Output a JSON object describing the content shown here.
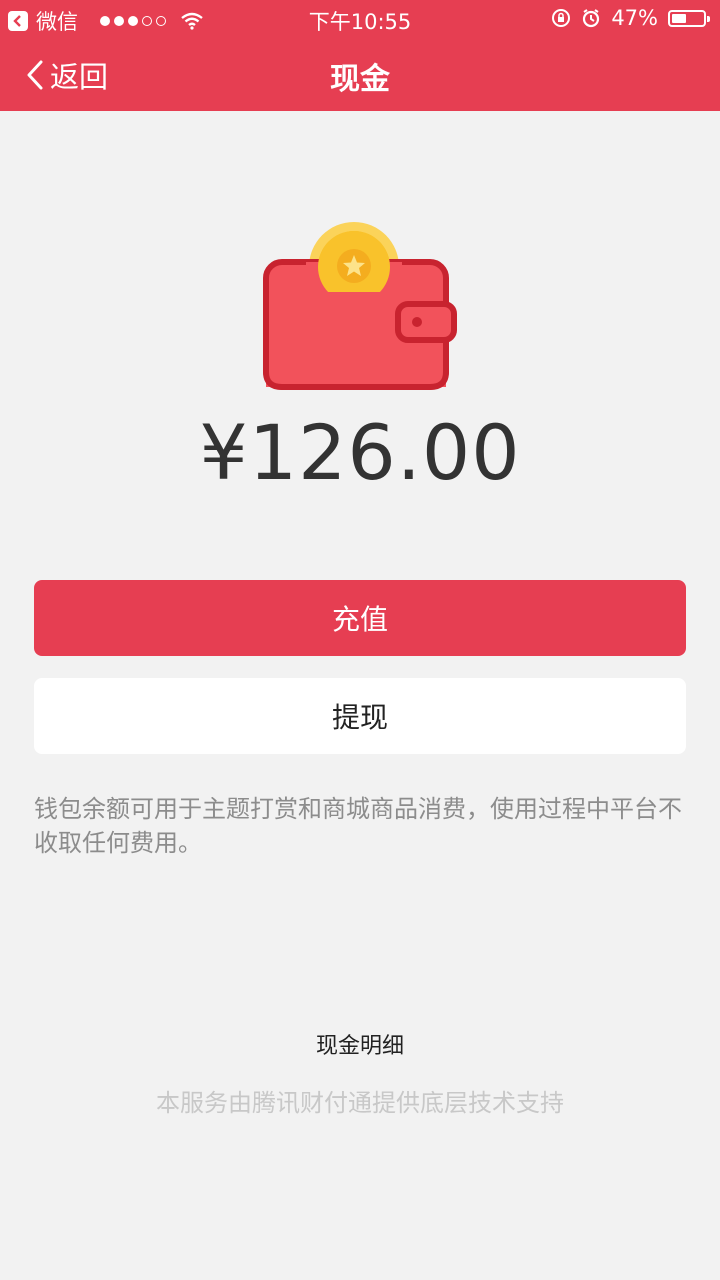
{
  "status_bar": {
    "carrier": "微信",
    "time": "下午10:55",
    "battery_percent": "47%",
    "battery_level": 0.47
  },
  "nav": {
    "back_label": "返回",
    "title": "现金"
  },
  "wallet": {
    "amount": "¥126.00"
  },
  "actions": {
    "recharge_label": "充值",
    "withdraw_label": "提现"
  },
  "note": "钱包余额可用于主题打赏和商城商品消费，使用过程中平台不收取任何费用。",
  "detail_link": "现金明细",
  "footer": "本服务由腾讯财付通提供底层技术支持",
  "colors": {
    "brand_red": "#e63e52",
    "wallet_body": "#f2525b",
    "wallet_border": "#c8232f",
    "coin": "#f9c22b"
  }
}
